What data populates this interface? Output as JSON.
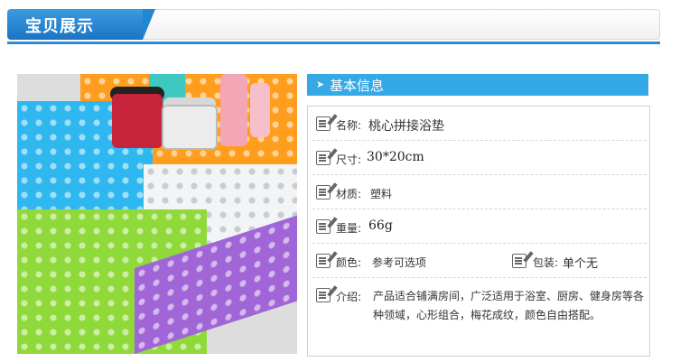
{
  "header": {
    "title": "宝贝展示"
  },
  "info": {
    "title": "基本信息",
    "rows": [
      {
        "label": "名称:",
        "value": "桃心拼接浴垫"
      },
      {
        "label": "尺寸:",
        "value": "30*20cm"
      },
      {
        "label": "材质:",
        "value": "塑料"
      },
      {
        "label": "重量:",
        "value": "66g"
      },
      {
        "label": "颜色:",
        "value": "参考可选项"
      },
      {
        "label": "包装:",
        "value": "单个无"
      },
      {
        "label": "介绍:",
        "value": "产品适合铺满房间，广泛适用于浴室、厨房、健身房等各种领域，心形组合，梅花成纹，颜色自由搭配。"
      }
    ]
  },
  "colors": {
    "header_blue": "#2287d1",
    "info_blue": "#34a9e6",
    "mat_blue": "#2fb7ef",
    "mat_orange": "#ff9d1e",
    "mat_white": "#f2f4f6",
    "mat_green": "#8fd93b",
    "mat_purple": "#a065d6"
  }
}
